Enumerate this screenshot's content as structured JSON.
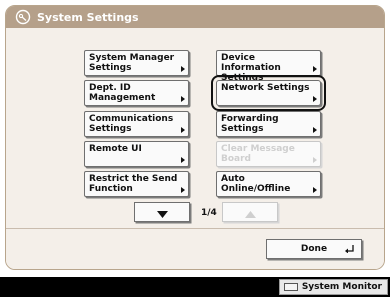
{
  "window": {
    "title": "System Settings",
    "title_icon": "settings-icon"
  },
  "menu": {
    "left": [
      {
        "label": "System Manager\nSettings",
        "enabled": true
      },
      {
        "label": "Dept. ID Management",
        "enabled": true
      },
      {
        "label": "Communications\nSettings",
        "enabled": true
      },
      {
        "label": "Remote UI",
        "enabled": true
      },
      {
        "label": "Restrict the Send\nFunction",
        "enabled": true
      }
    ],
    "right": [
      {
        "label": "Device Information\nSettings",
        "enabled": true
      },
      {
        "label": "Network Settings",
        "enabled": true,
        "highlighted": true
      },
      {
        "label": "Forwarding Settings",
        "enabled": true
      },
      {
        "label": "Clear Message Board",
        "enabled": false
      },
      {
        "label": "Auto Online/Offline",
        "enabled": true
      }
    ]
  },
  "pager": {
    "page": "1/4",
    "next_icon": "down-arrow-icon",
    "prev_icon": "up-arrow-icon",
    "prev_enabled": false
  },
  "footer": {
    "done_label": "Done",
    "done_icon": "enter-icon"
  },
  "statusbar": {
    "system_monitor_label": "System Monitor",
    "icon": "monitor-icon"
  },
  "colors": {
    "title_bar": "#b5a08a",
    "frame_border": "#b8a58c",
    "background": "#f4efe9",
    "status_bar": "#000000"
  }
}
